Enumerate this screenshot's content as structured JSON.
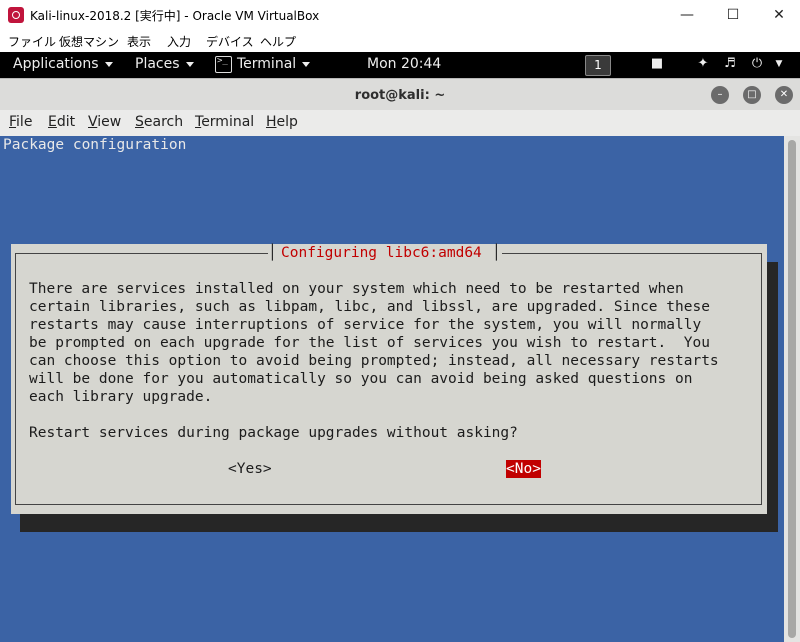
{
  "host_window": {
    "title": "Kali-linux-2018.2 [実行中] - Oracle VM VirtualBox",
    "minimize_glyph": "—",
    "maximize_glyph": "☐",
    "close_glyph": "✕",
    "menu": [
      "ファイル",
      "仮想マシン",
      "表示",
      "入力",
      "デバイス",
      "ヘルプ"
    ]
  },
  "gnome_topbar": {
    "applications": "Applications",
    "places": "Places",
    "terminal": "Terminal",
    "clock": "Mon 20:44",
    "workspace": "1",
    "tray_icons": [
      "display-icon",
      "network-icon",
      "volume-icon",
      "power-icon"
    ]
  },
  "terminal_window": {
    "title": "root@kali: ~",
    "menu": [
      "File",
      "Edit",
      "View",
      "Search",
      "Terminal",
      "Help"
    ]
  },
  "screen": {
    "header": "Package configuration",
    "dialog": {
      "title": "Configuring libc6:amd64",
      "body": "There are services installed on your system which need to be restarted when\ncertain libraries, such as libpam, libc, and libssl, are upgraded. Since these\nrestarts may cause interruptions of service for the system, you will normally\nbe prompted on each upgrade for the list of services you wish to restart.  You\ncan choose this option to avoid being prompted; instead, all necessary restarts\nwill be done for you automatically so you can avoid being asked questions on\neach library upgrade.",
      "question": "Restart services during package upgrades without asking?",
      "yes_label": "<Yes>",
      "no_label": "<No>",
      "selected": "no"
    }
  },
  "colors": {
    "terminal_bg": "#3b63a5",
    "dialog_bg": "#d6d6d0",
    "title_red": "#c10000"
  }
}
